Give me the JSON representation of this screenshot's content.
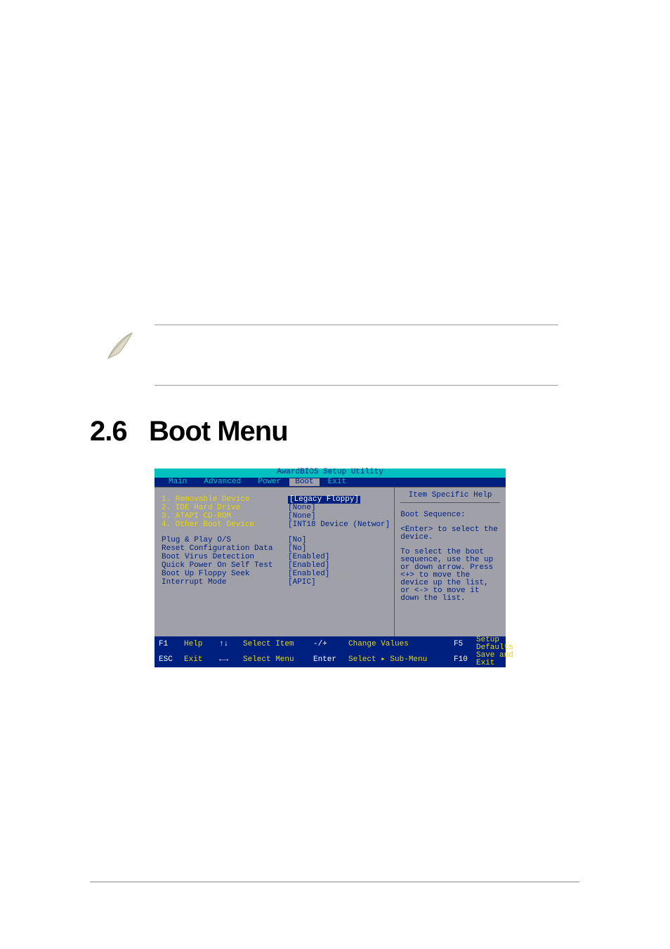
{
  "section": {
    "number": "2.6",
    "title": "Boot Menu"
  },
  "bios": {
    "title": "AwardBIOS Setup Utility",
    "tabs": [
      "Main",
      "Advanced",
      "Power",
      "Boot",
      "Exit"
    ],
    "active_tab": "Boot",
    "main": {
      "rows": [
        {
          "label": "1. Removable Device",
          "value": "[Legacy Floppy]",
          "highlight": true,
          "yellow": true
        },
        {
          "label": "2. IDE Hard Drive",
          "value": "[None]",
          "yellow": true
        },
        {
          "label": "3. ATAPI CD-ROM",
          "value": "[None]",
          "yellow": true
        },
        {
          "label": "4. Other Boot Device",
          "value": "[INT18 Device (Networ]",
          "yellow": true
        }
      ],
      "rows2": [
        {
          "label": "Plug & Play O/S",
          "value": "[No]"
        },
        {
          "label": "Reset Configuration Data",
          "value": "[No]"
        },
        {
          "label": "Boot Virus Detection",
          "value": "[Enabled]"
        },
        {
          "label": "Quick Power On Self Test",
          "value": "[Enabled]"
        },
        {
          "label": "Boot Up Floppy Seek",
          "value": "[Enabled]"
        },
        {
          "label": "Interrupt Mode",
          "value": "[APIC]"
        }
      ]
    },
    "help": {
      "title": "Item Specific Help",
      "line1": "Boot Sequence:",
      "line2": "<Enter> to select the device.",
      "line3": "To select the boot sequence, use the up or down arrow. Press <+> to move the device up the list, or <-> to move it down the list."
    },
    "footer": {
      "k1": "F1",
      "l1": "Help",
      "k2": "↑↓",
      "l2": "Select Item",
      "k3": "-/+",
      "l3": "Change Values",
      "k4": "F5",
      "l4": "Setup Defaults",
      "k5": "ESC",
      "l5": "Exit",
      "k6": "←→",
      "l6": "Select Menu",
      "k7": "Enter",
      "l7": "Select ▸ Sub-Menu",
      "k8": "F10",
      "l8": "Save and Exit"
    }
  }
}
